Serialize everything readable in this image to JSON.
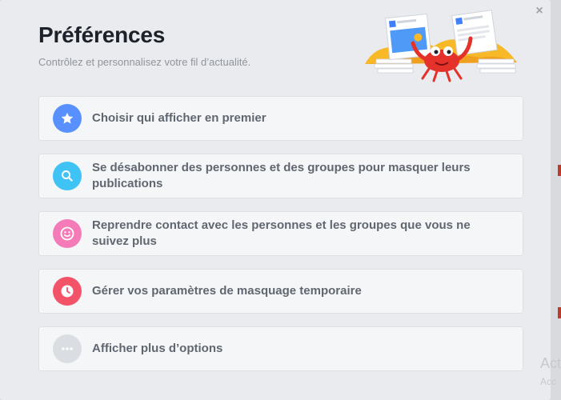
{
  "dialog": {
    "title": "Préférences",
    "subtitle": "Contrôlez et personnalisez votre fil d’actualité.",
    "close_icon": "close-icon",
    "close_glyph": "×"
  },
  "options": [
    {
      "label": "Choisir qui afficher en premier",
      "icon": "star-icon",
      "color": "#5890ff"
    },
    {
      "label": "Se désabonner des personnes et des groupes pour masquer leurs publications",
      "icon": "search-icon",
      "color": "#3fc3f4"
    },
    {
      "label": "Reprendre contact avec les personnes et les groupes que vous ne suivez plus",
      "icon": "smiley-icon",
      "color": "#f57ab8"
    },
    {
      "label": "Gérer vos paramètres de masquage temporaire",
      "icon": "clock-icon",
      "color": "#f35369"
    },
    {
      "label": "Afficher plus d’options",
      "icon": "more-icon",
      "color": "#dadde1"
    }
  ],
  "background_watermark": {
    "line1": "Act",
    "line2": "Acc"
  }
}
